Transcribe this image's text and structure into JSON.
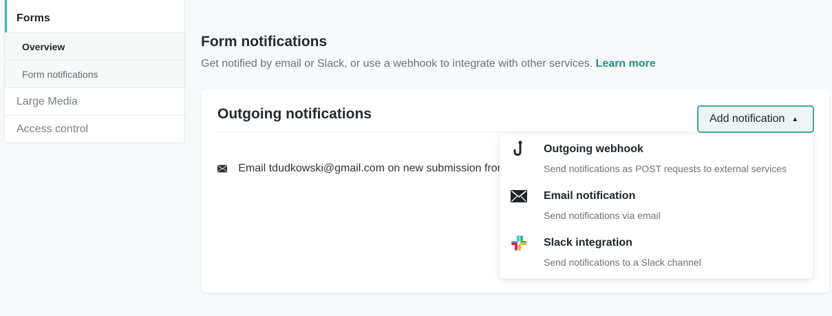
{
  "sidebar": {
    "items": [
      {
        "label": "Forms"
      },
      {
        "label": "Overview"
      },
      {
        "label": "Form notifications"
      },
      {
        "label": "Large Media"
      },
      {
        "label": "Access control"
      }
    ]
  },
  "header": {
    "title": "Form notifications",
    "description": "Get notified by email or Slack, or use a webhook to integrate with other services.",
    "learn_more": "Learn more"
  },
  "card": {
    "title": "Outgoing notifications",
    "add_button": "Add notification",
    "notification_row": "Email tdudkowski@gmail.com on new submission from"
  },
  "dropdown": {
    "items": [
      {
        "label": "Outgoing webhook",
        "description": "Send notifications as POST requests to external services",
        "icon": "webhook-icon"
      },
      {
        "label": "Email notification",
        "description": "Send notifications via email",
        "icon": "email-icon"
      },
      {
        "label": "Slack integration",
        "description": "Send notifications to a Slack channel",
        "icon": "slack-icon"
      }
    ]
  },
  "colors": {
    "accent": "#30c2b4",
    "link": "#218f85",
    "button_border": "#3fa89d"
  }
}
